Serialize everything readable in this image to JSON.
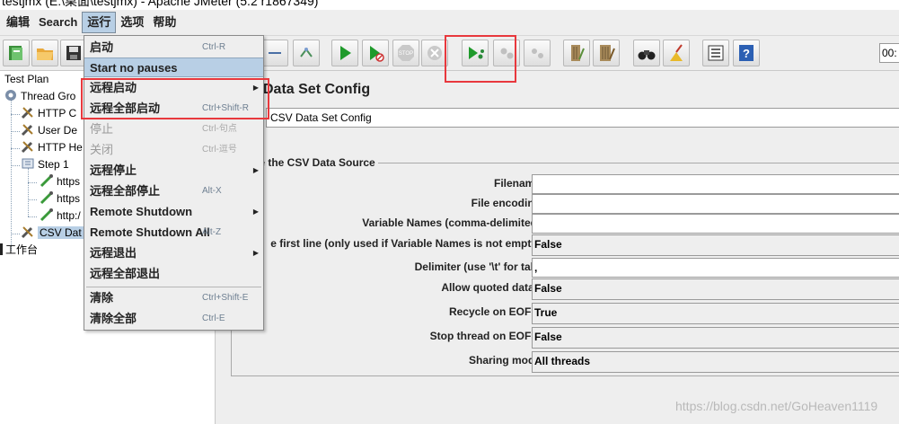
{
  "window": {
    "title": "testjmx (E:\\桌面\\testjmx) - Apache JMeter (5.2 r1867349)"
  },
  "menubar": [
    "编辑",
    "Search",
    "运行",
    "选项",
    "帮助"
  ],
  "timer": "00:",
  "tree": {
    "nodes": [
      "Test Plan",
      "Thread Gro",
      "HTTP C",
      "User De",
      "HTTP He",
      "Step 1",
      "https",
      "https",
      "http:/",
      "CSV Dat",
      "工作台"
    ]
  },
  "panel": {
    "title": "Data Set Config",
    "name_value": "CSV Data Set Config",
    "fieldset_legend": "gure the CSV Data Source",
    "rows": [
      {
        "label": "Filename:",
        "value": ""
      },
      {
        "label": "File encoding:",
        "value": ""
      },
      {
        "label": "Variable Names (comma-delimited):",
        "value": ""
      },
      {
        "label": "e first line (only used if Variable Names is not empty):",
        "value": "False"
      },
      {
        "label": "Delimiter (use '\\t' for tab):",
        "value": ","
      },
      {
        "label": "Allow quoted data?:",
        "value": "False"
      },
      {
        "label": "Recycle on EOF ?:",
        "value": "True"
      },
      {
        "label": "Stop thread on EOF ?:",
        "value": "False"
      },
      {
        "label": "Sharing mode:",
        "value": "All threads"
      }
    ]
  },
  "run_menu": {
    "items": [
      {
        "label": "启动",
        "accel": "Ctrl-R"
      },
      {
        "label": "Start no pauses",
        "accel": ""
      },
      {
        "label": "远程启动",
        "accel": ""
      },
      {
        "label": "远程全部启动",
        "accel": "Ctrl+Shift-R"
      },
      {
        "label": "停止",
        "accel": "Ctrl-句点"
      },
      {
        "label": "关闭",
        "accel": "Ctrl-逗号"
      },
      {
        "label": "远程停止",
        "accel": ""
      },
      {
        "label": "远程全部停止",
        "accel": "Alt-X"
      },
      {
        "label": "Remote Shutdown",
        "accel": ""
      },
      {
        "label": "Remote Shutdown All",
        "accel": "Alt-Z"
      },
      {
        "label": "远程退出",
        "accel": ""
      },
      {
        "label": "远程全部退出",
        "accel": ""
      },
      {
        "label": "清除",
        "accel": "Ctrl+Shift-E"
      },
      {
        "label": "清除全部",
        "accel": "Ctrl-E"
      }
    ]
  },
  "watermark": "https://blog.csdn.net/GoHeaven1119"
}
